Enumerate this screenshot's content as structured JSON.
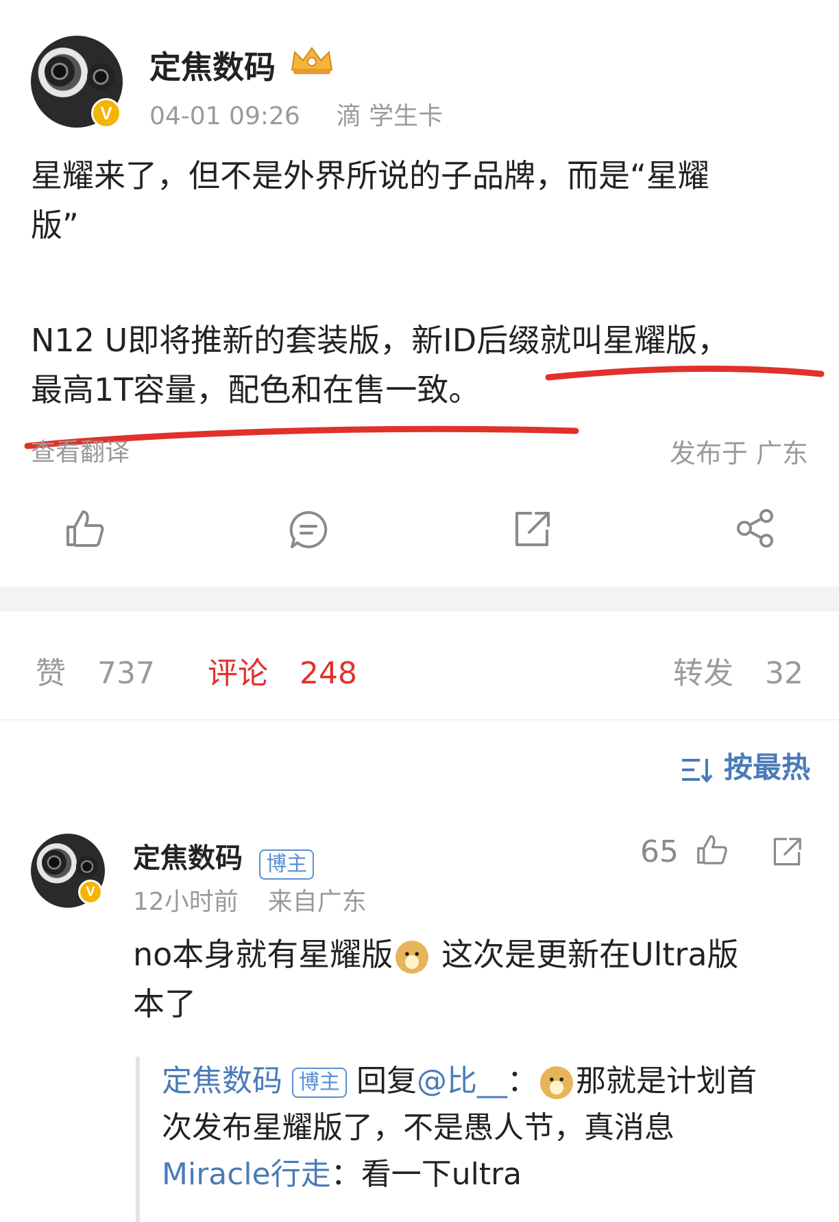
{
  "post": {
    "author": "定焦数码",
    "time": "04-01 09:26",
    "source": "滴 学生卡",
    "text_line1": "星耀来了，但不是外界所说的子品牌，而是“星耀",
    "text_line2": "版”",
    "text_line3": "N12 U即将推新的套装版，新ID后缀就叫星耀版，",
    "text_line4": "最高1T容量，配色和在售一致。",
    "translate": "查看翻译",
    "location": "发布于 广东",
    "avatar_badge": "V"
  },
  "stats": {
    "like_label": "赞",
    "like_count": "737",
    "comment_label": "评论",
    "comment_count": "248",
    "repost_label": "转发",
    "repost_count": "32"
  },
  "sort": {
    "label": "按最热"
  },
  "comment": {
    "author": "定焦数码",
    "tag": "博主",
    "like_count": "65",
    "time": "12小时前",
    "from": "来自广东",
    "text_a": "no本身就有星耀版",
    "text_b": "这次是更新在Ultra版",
    "text_c": "本了",
    "replies": [
      {
        "author": "定焦数码",
        "tag": "博主",
        "reply_word": "回复",
        "mention": "@比__",
        "colon": "：",
        "text_a": "那就是计划首",
        "text_b": "次发布星耀版了，不是愚人节，真消息"
      },
      {
        "author": "Miracle行走",
        "colon": "：",
        "text": "看一下ultra"
      }
    ]
  },
  "colors": {
    "accent_link": "#4a7bb8",
    "comment_active": "#e0312b",
    "muted": "#9a9a9a",
    "underline": "#e0312b"
  },
  "icons": [
    "crown-icon",
    "like-icon",
    "comment-icon",
    "repost-icon",
    "share-icon",
    "sort-icon",
    "doge-emoji"
  ]
}
